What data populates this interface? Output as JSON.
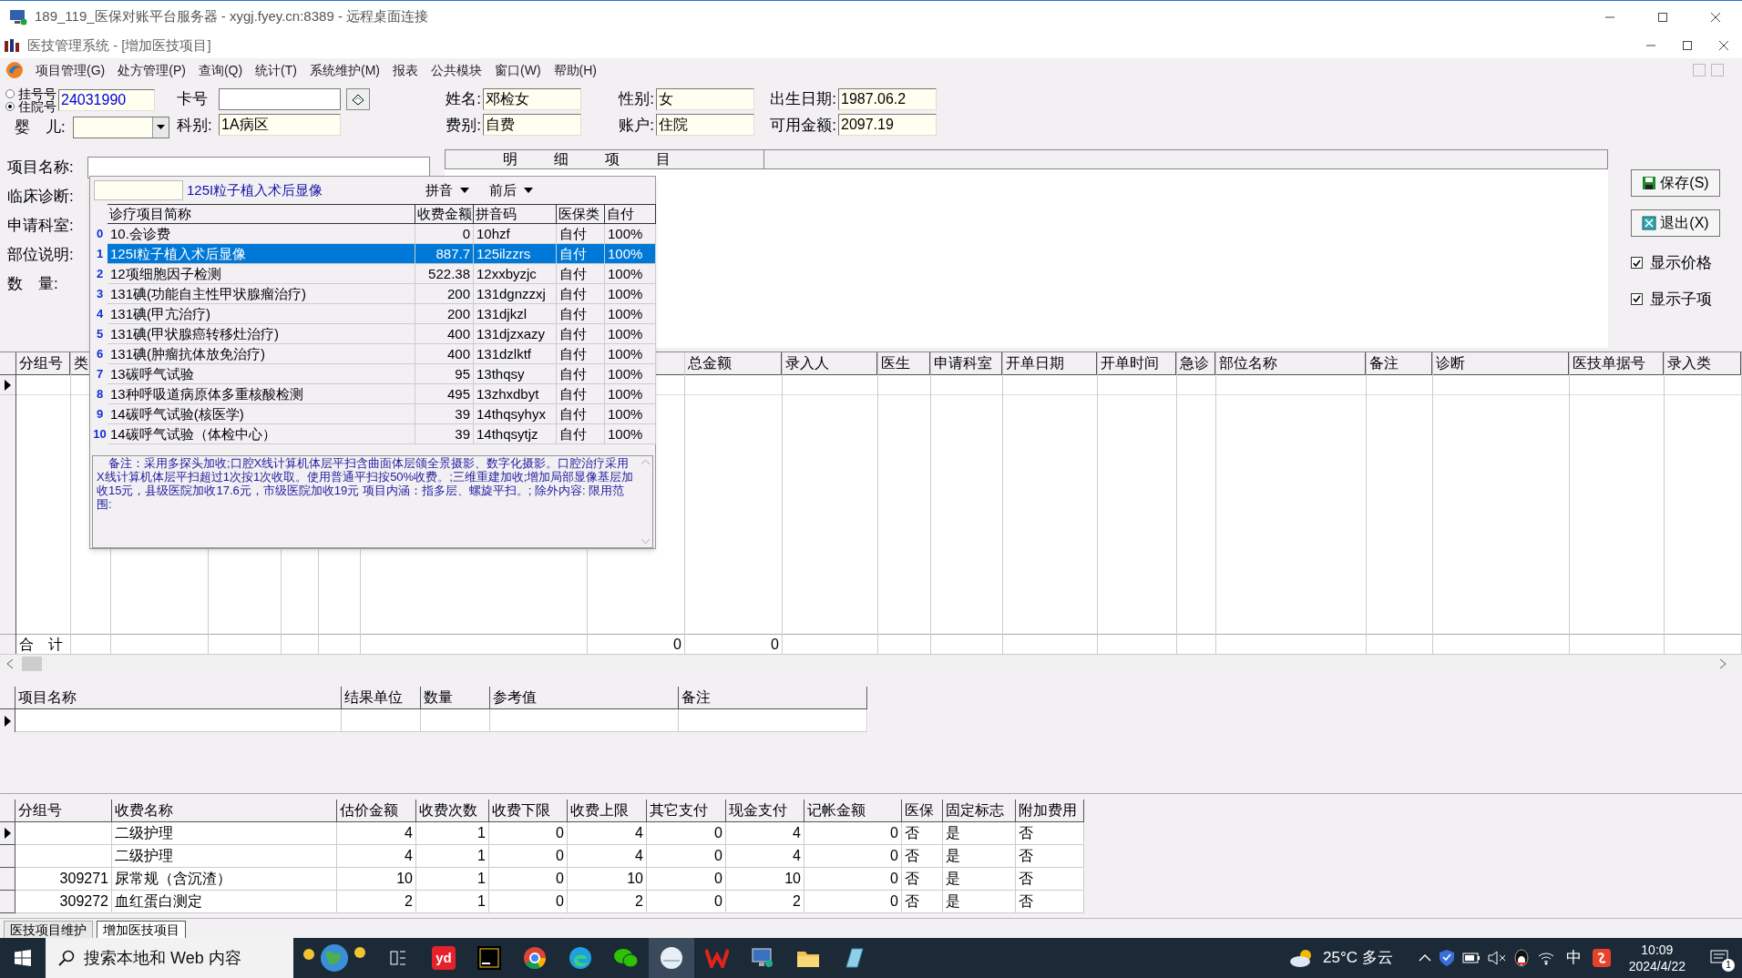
{
  "remote_window": {
    "title": "189_119_医保对账平台服务器 - xygj.fyey.cn:8389 - 远程桌面连接"
  },
  "app_window": {
    "title": "医技管理系统 - [增加医技项目]"
  },
  "menu": [
    "项目管理(G)",
    "处方管理(P)",
    "查询(Q)",
    "统计(T)",
    "系统维护(M)",
    "报表",
    "公共模块",
    "窗口(W)",
    "帮助(H)"
  ],
  "patient": {
    "id_types": [
      {
        "label": "挂号号",
        "selected": false
      },
      {
        "label": "住院号",
        "selected": true
      }
    ],
    "id_value": "24031990",
    "baby_label": "婴　儿:",
    "card_label": "卡号",
    "dept_label": "科别:",
    "dept_value": "1A病区",
    "fields": [
      {
        "label": "姓名:",
        "value": "邓检女"
      },
      {
        "label": "性别:",
        "value": "女"
      },
      {
        "label": "出生日期:",
        "value": "1987.06.2"
      },
      {
        "label": "费别:",
        "value": "自费"
      },
      {
        "label": "账户:",
        "value": "住院"
      },
      {
        "label": "可用金额:",
        "value": "2097.19"
      }
    ]
  },
  "form": {
    "labels": [
      "项目名称:",
      "临床诊断:",
      "申请科室:",
      "部位说明:",
      "数　量:"
    ],
    "detail_header": "明细项目"
  },
  "actions": [
    {
      "label": "保存(S)",
      "kind": "save"
    },
    {
      "label": "退出(X)",
      "kind": "exit"
    }
  ],
  "options": [
    {
      "label": "显示价格",
      "checked": true
    },
    {
      "label": "显示子项",
      "checked": true
    }
  ],
  "popup": {
    "selected_text": "125I粒子植入术后显像",
    "sort_options": [
      "拼音",
      "前后"
    ],
    "columns": [
      "诊疗项目简称",
      "收费金额",
      "拼音码",
      "医保类",
      "自付"
    ],
    "rows": [
      {
        "index": "0",
        "selected": false,
        "cells": [
          "10.会诊费",
          "0",
          "10hzf",
          "自付",
          "100%"
        ]
      },
      {
        "index": "1",
        "selected": true,
        "cells": [
          "125I粒子植入术后显像",
          "887.7",
          "125ilzzrs",
          "自付",
          "100%"
        ]
      },
      {
        "index": "2",
        "selected": false,
        "cells": [
          "12项细胞因子检测",
          "522.38",
          "12xxbyzjc",
          "自付",
          "100%"
        ]
      },
      {
        "index": "3",
        "selected": false,
        "cells": [
          "131碘(功能自主性甲状腺瘤治疗)",
          "200",
          "131dgnzzxj",
          "自付",
          "100%"
        ]
      },
      {
        "index": "4",
        "selected": false,
        "cells": [
          "131碘(甲亢治疗)",
          "200",
          "131djkzl",
          "自付",
          "100%"
        ]
      },
      {
        "index": "5",
        "selected": false,
        "cells": [
          "131碘(甲状腺癌转移灶治疗)",
          "400",
          "131djzxazy",
          "自付",
          "100%"
        ]
      },
      {
        "index": "6",
        "selected": false,
        "cells": [
          "131碘(肿瘤抗体放免治疗)",
          "400",
          "131dzlktf",
          "自付",
          "100%"
        ]
      },
      {
        "index": "7",
        "selected": false,
        "cells": [
          "13碳呼气试验",
          "95",
          "13thqsy",
          "自付",
          "100%"
        ]
      },
      {
        "index": "8",
        "selected": false,
        "cells": [
          "13种呼吸道病原体多重核酸检测",
          "495",
          "13zhxdbyt",
          "自付",
          "100%"
        ]
      },
      {
        "index": "9",
        "selected": false,
        "cells": [
          "14碳呼气试验(核医学)",
          "39",
          "14thqsyhyx",
          "自付",
          "100%"
        ]
      },
      {
        "index": "10",
        "selected": false,
        "cells": [
          "14碳呼气试验（体检中心）",
          "39",
          "14thqsytjz",
          "自付",
          "100%"
        ]
      }
    ],
    "notes": "　备注：采用多探头加收;口腔X线计算机体层平扫含曲面体层颌全景摄影、数字化摄影。口腔治疗采用X线计算机体层平扫超过1次按1次收取。使用普通平扫按50%收费。;三维重建加收;增加局部显像基层加收15元，县级医院加收17.6元，市级医院加收19元 项目内涵：指多层、螺旋平扫。; 除外内容:  限用范围:"
  },
  "main_grid": {
    "columns": [
      "分组号",
      "类",
      "总金额",
      "录入人",
      "医生",
      "申请科室",
      "开单日期",
      "开单时间",
      "急诊",
      "部位名称",
      "备注",
      "诊断",
      "医技单据号",
      "录入类"
    ],
    "total_label": "合　计",
    "totals": [
      "0",
      "0"
    ]
  },
  "result_grid": {
    "columns": [
      "项目名称",
      "结果单位",
      "数量",
      "参考值",
      "备注"
    ]
  },
  "fee_grid": {
    "columns": [
      "分组号",
      "收费名称",
      "估价金额",
      "收费次数",
      "收费下限",
      "收费上限",
      "其它支付",
      "现金支付",
      "记帐金额",
      "医保",
      "固定标志",
      "附加费用"
    ],
    "rows": [
      {
        "current": true,
        "cells": [
          "",
          "二级护理",
          "4",
          "1",
          "0",
          "4",
          "0",
          "4",
          "0",
          "否",
          "是",
          "否"
        ]
      },
      {
        "current": false,
        "cells": [
          "",
          "二级护理",
          "4",
          "1",
          "0",
          "4",
          "0",
          "4",
          "0",
          "否",
          "是",
          "否"
        ]
      },
      {
        "current": false,
        "cells": [
          "309271",
          "尿常规（含沉渣）",
          "10",
          "1",
          "0",
          "10",
          "0",
          "10",
          "0",
          "否",
          "是",
          "否"
        ]
      },
      {
        "current": false,
        "cells": [
          "309272",
          "血红蛋白测定",
          "2",
          "1",
          "0",
          "2",
          "0",
          "2",
          "0",
          "否",
          "是",
          "否"
        ]
      }
    ]
  },
  "tabs": [
    {
      "label": "医技项目维护",
      "selected": false
    },
    {
      "label": "增加医技项目",
      "selected": true
    }
  ],
  "taskbar": {
    "search_placeholder": "搜索本地和 Web 内容",
    "yd_label": "yd",
    "weather": "25°C 多云",
    "ime": "中",
    "time": "10:09",
    "date": "2024/4/22",
    "notifications": "1"
  }
}
